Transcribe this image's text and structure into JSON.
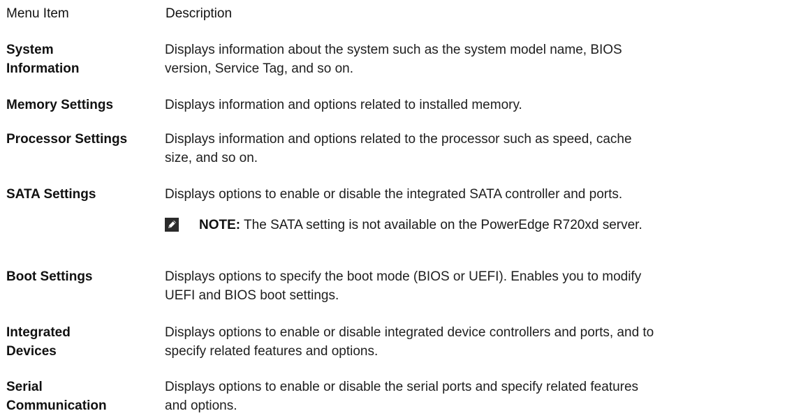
{
  "header": {
    "menu_item": "Menu Item",
    "description": "Description"
  },
  "rows": [
    {
      "term_lines": [
        "System",
        "Information"
      ],
      "desc_lines": [
        "Displays information about the system such as the system model name, BIOS",
        "version, Service Tag, and so on."
      ]
    },
    {
      "term_lines": [
        "Memory Settings"
      ],
      "desc_lines": [
        "Displays information and options related to installed memory."
      ]
    },
    {
      "term_lines": [
        "Processor Settings"
      ],
      "desc_lines": [
        "Displays information and options related to the processor such as speed, cache",
        "size, and so on."
      ]
    },
    {
      "term_lines": [
        "SATA Settings"
      ],
      "desc_lines": [
        "Displays options to enable or disable the integrated SATA controller and ports."
      ]
    },
    {
      "term_lines": [
        "Boot Settings"
      ],
      "desc_lines": [
        "Displays options to specify the boot mode (BIOS or UEFI). Enables you to modify",
        "UEFI and BIOS boot settings."
      ]
    },
    {
      "term_lines": [
        "Integrated",
        "Devices"
      ],
      "desc_lines": [
        "Displays options to enable or disable integrated device controllers and ports, and to",
        "specify related features and options."
      ]
    },
    {
      "term_lines": [
        "Serial",
        "Communication"
      ],
      "desc_lines": [
        "Displays options to enable or disable the serial ports and specify related features",
        "and options."
      ]
    }
  ],
  "note": {
    "icon": "pencil-icon",
    "label": "NOTE:",
    "text": " The SATA setting is not available on the PowerEdge R720xd server."
  }
}
